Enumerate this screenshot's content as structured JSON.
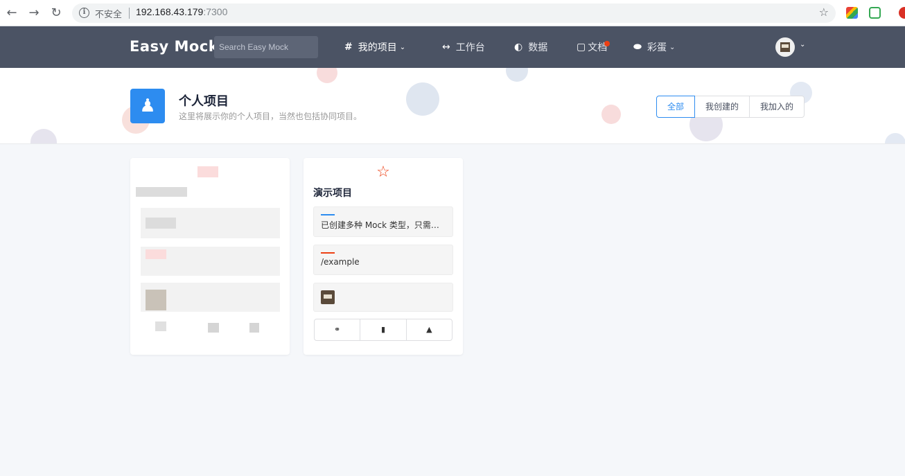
{
  "browser": {
    "insecure_label": "不安全",
    "url_host": "192.168.43.179",
    "url_port": ":7300"
  },
  "header": {
    "logo": "Easy Mock",
    "search_placeholder": "Search Easy Mock",
    "menu": {
      "projects": "我的项目",
      "workbench": "工作台",
      "data": "数据",
      "docs": "文档",
      "easter_egg": "彩蛋"
    }
  },
  "hero": {
    "title": "个人项目",
    "description": "这里将展示你的个人项目，当然也包括协同项目。",
    "filters": [
      "全部",
      "我创建的",
      "我加入的"
    ],
    "active_filter": "全部"
  },
  "projects": [
    {
      "name": "演示项目",
      "description": "已创建多种 Mock 类型，只需点...",
      "base_url": "/example",
      "description_bar_color": "#2d8cf0",
      "url_bar_color": "#ed4014"
    }
  ],
  "colors": {
    "header_bg": "#4b5364",
    "accent": "#2d8cf0",
    "danger": "#ed4014"
  }
}
